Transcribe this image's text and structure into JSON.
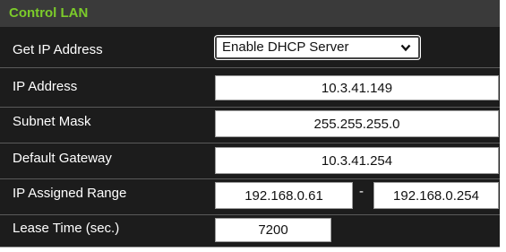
{
  "section": {
    "title": "Control LAN"
  },
  "fields": {
    "get_ip": {
      "label": "Get IP Address",
      "selected": "Enable DHCP Server"
    },
    "ip_address": {
      "label": "IP Address",
      "value": "10.3.41.149"
    },
    "subnet_mask": {
      "label": "Subnet Mask",
      "value": "255.255.255.0"
    },
    "gateway": {
      "label": "Default Gateway",
      "value": "10.3.41.254"
    },
    "ip_range": {
      "label": "IP Assigned Range",
      "start": "192.168.0.61",
      "separator": "-",
      "end": "192.168.0.254"
    },
    "lease_time": {
      "label": "Lease Time (sec.)",
      "value": "7200"
    }
  },
  "icons": {
    "dropdown": "chevron-down-icon"
  },
  "colors": {
    "accent": "#7ccb2a",
    "background": "#1c1c1c",
    "header": "#3a3a3a"
  }
}
